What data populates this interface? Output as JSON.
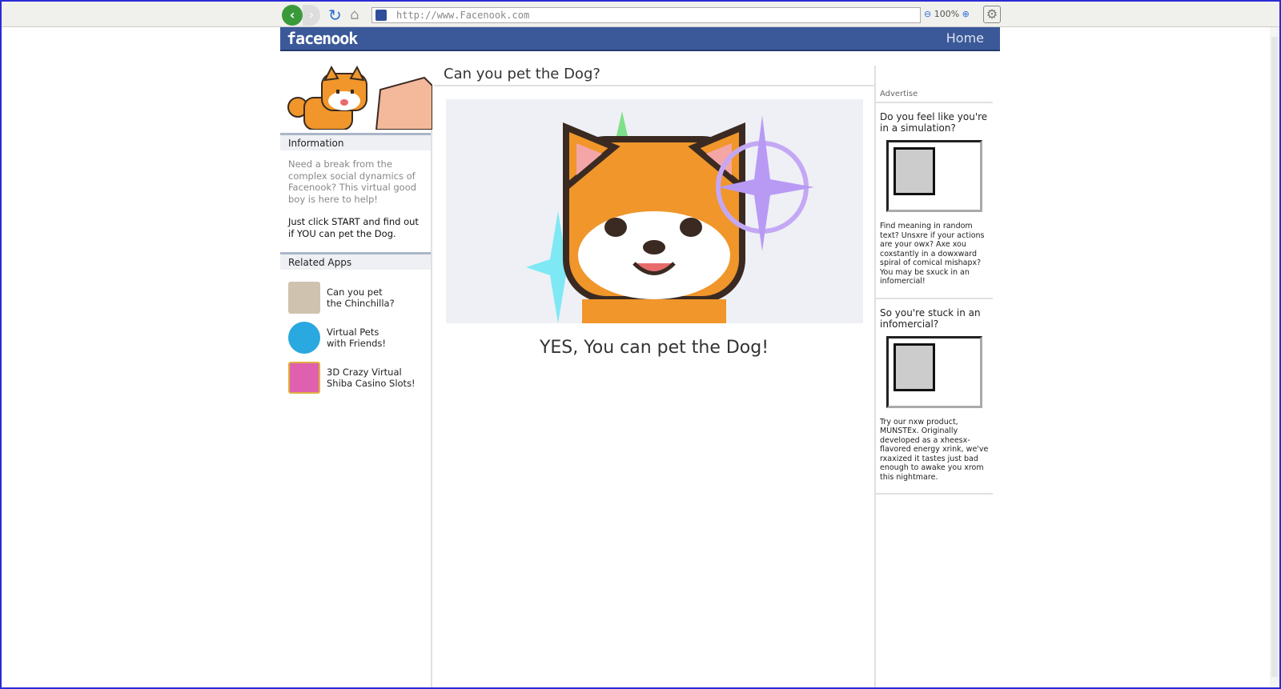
{
  "browser": {
    "url": "http://www.Facenook.com",
    "zoom": "100%"
  },
  "header": {
    "logo": "facenook",
    "home": "Home"
  },
  "sidebar": {
    "info_title": "Information",
    "info_text": "Need a break from the complex social dynamics of Facenook? This virtual good boy is here to help!",
    "info_cta": "Just click START and find out if YOU can pet the Dog.",
    "related_title": "Related Apps",
    "apps": [
      {
        "line1": "Can you pet",
        "line2": "the Chinchilla?"
      },
      {
        "line1": "Virtual Pets",
        "line2": "with Friends!"
      },
      {
        "line1": "3D Crazy Virtual",
        "line2": "Shiba Casino Slots!"
      }
    ]
  },
  "main": {
    "title": "Can you pet the Dog?",
    "result": "YES, You can pet the Dog!"
  },
  "ads": {
    "header": "Advertise",
    "items": [
      {
        "title": "Do you feel like you're in a simulation?",
        "text": "Find meaning in random text? Unsxre if your actions are your owx? Axe xou coxstantly in a dowxward spiral of comical mishapx? You may be sxuck in an infomercial!"
      },
      {
        "title": "So you're stuck in an infomercial?",
        "text": "Try our nxw product, MUNSTEx. Originally developed as a xheesx-flavored energy xrink, we've rxaxized it tastes just bad enough to awake you xrom this nightmare."
      }
    ]
  },
  "colors": {
    "brand": "#3b5998",
    "frame": "#2b2bd6"
  }
}
